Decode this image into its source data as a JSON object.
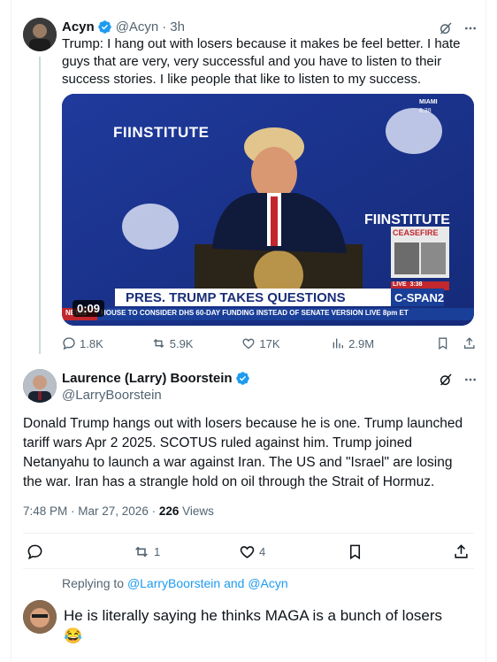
{
  "parent_tweet": {
    "author_name": "Acyn",
    "handle": "@Acyn",
    "separator": "·",
    "time": "3h",
    "text": "Trump: I hang out with losers because it makes be feel better. I hate guys that are very, very successful and you have to listen to their success stories. I like people that like to listen to my success.",
    "media": {
      "duration": "0:09",
      "banner_main": "PRES. TRUMP TAKES QUESTIONS",
      "banner_brand": "C-SPAN2",
      "ticker_prefix": "NEWS",
      "ticker": "HOUSE TO CONSIDER DHS 60-DAY FUNDING  INSTEAD OF SENATE VERSION LIVE 8pm ET",
      "logo_text": "FIINSTITUTE",
      "logo_text_2": "FIINSTITUTE",
      "location": "MIAMI",
      "clock": "6:38",
      "live_label": "LIVE",
      "live_time": "3:38",
      "inset_label": "CEASEFIRE",
      "brand_color": "#1b2a6b"
    },
    "metrics": {
      "replies": "1.8K",
      "reposts": "5.9K",
      "likes": "17K",
      "views": "2.9M"
    }
  },
  "main_tweet": {
    "author_name": "Laurence (Larry) Boorstein",
    "handle": "@LarryBoorstein",
    "text_lines": [
      "Donald Trump hangs out with losers because he is one.  Trump launched",
      "tariff wars Apr 2 2025.  SCOTUS ruled against him. Trump joined",
      "Netanyahu to launch a war against Iran.  The US and \"Israel\" are losing",
      "the war.  Iran has a strangle hold on oil through the Strait of Hormuz."
    ],
    "timestamp": "7:48 PM · Mar 27, 2026 · ",
    "views_count": "226",
    "views_label": " Views",
    "actions": {
      "reposts": "1",
      "likes": "4"
    }
  },
  "reply": {
    "replying_prefix": "Replying to ",
    "replying_to_1": "@LarryBoorstein",
    "replying_and": " and ",
    "replying_to_2": "@Acyn",
    "text": "He is literally saying he thinks MAGA is a bunch of losers",
    "emoji": "😂"
  },
  "colors": {
    "verified": "#1d9bf0",
    "link": "#1d9bf0",
    "muted": "#536471"
  }
}
